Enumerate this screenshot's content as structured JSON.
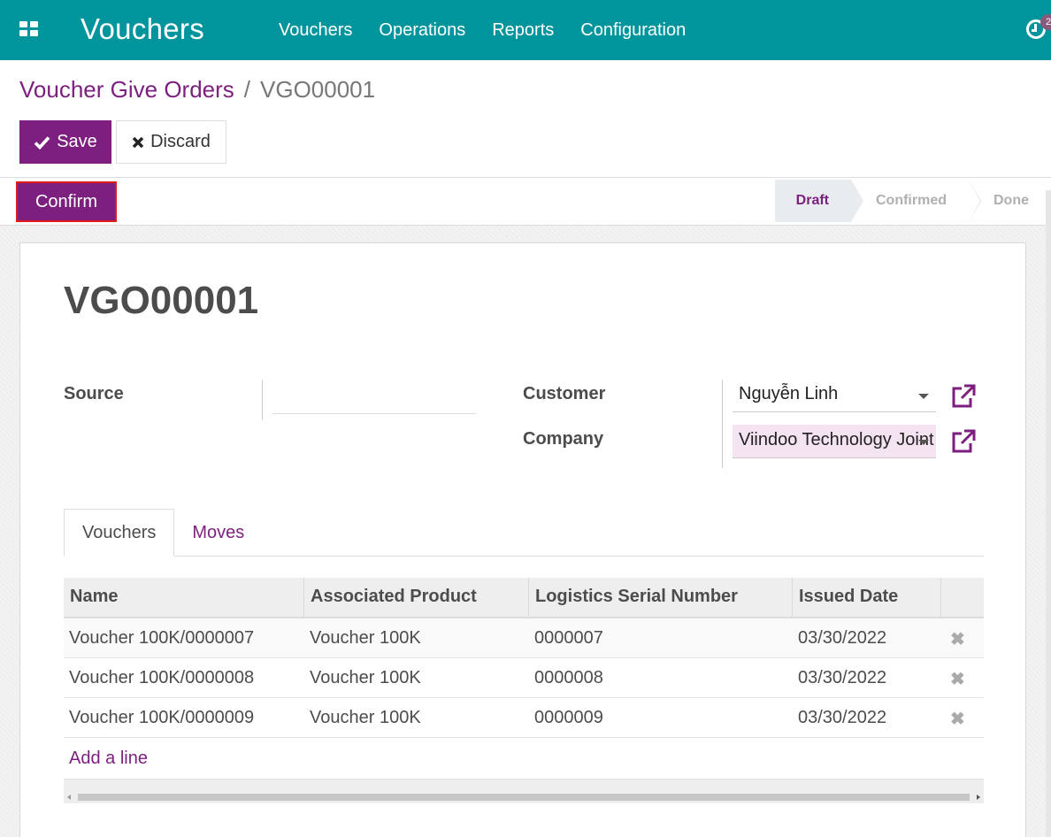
{
  "navbar": {
    "app_title": "Vouchers",
    "menu": [
      "Vouchers",
      "Operations",
      "Reports",
      "Configuration"
    ],
    "activity_badge": "2",
    "bg_color": "#00949c"
  },
  "breadcrumb": {
    "parent": "Voucher Give Orders",
    "separator": "/",
    "current": "VGO00001"
  },
  "buttons": {
    "save": "Save",
    "discard": "Discard",
    "confirm": "Confirm"
  },
  "statusbar": {
    "stages": [
      "Draft",
      "Confirmed",
      "Done"
    ],
    "active": "Draft"
  },
  "form": {
    "title": "VGO00001",
    "source_label": "Source",
    "source_value": "",
    "customer_label": "Customer",
    "customer_value": "Nguyễn Linh",
    "company_label": "Company",
    "company_value": "Viindoo Technology Joint Stock Company"
  },
  "tabs": [
    {
      "label": "Vouchers",
      "active": true
    },
    {
      "label": "Moves",
      "active": false
    }
  ],
  "table": {
    "columns": [
      "Name",
      "Associated Product",
      "Logistics Serial Number",
      "Issued Date"
    ],
    "rows": [
      [
        "Voucher 100K/0000007",
        "Voucher 100K",
        "0000007",
        "03/30/2022"
      ],
      [
        "Voucher 100K/0000008",
        "Voucher 100K",
        "0000008",
        "03/30/2022"
      ],
      [
        "Voucher 100K/0000009",
        "Voucher 100K",
        "0000009",
        "03/30/2022"
      ]
    ],
    "add_line": "Add a line"
  },
  "colors": {
    "primary": "#7c1f7e",
    "required_field": "#f4e3f1",
    "highlight_border": "#e01b1b"
  }
}
